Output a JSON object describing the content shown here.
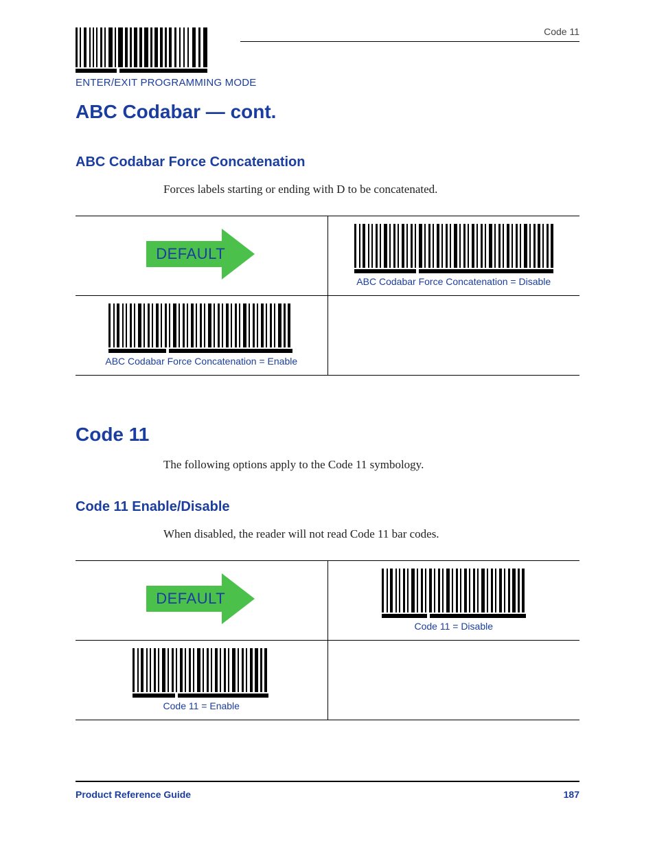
{
  "header": {
    "section_label": "Code 11",
    "enter_exit": "ENTER/EXIT PROGRAMMING MODE"
  },
  "titles": {
    "main": "ABC Codabar — cont.",
    "sub1": "ABC Codabar Force Concatenation",
    "section2": "Code 11",
    "sub2": "Code 11 Enable/Disable"
  },
  "paragraphs": {
    "p1": "Forces labels starting or ending with D to be concatenated.",
    "p2": "The following options apply to the Code 11 symbology.",
    "p3": "When disabled, the reader will not read Code 11 bar codes."
  },
  "arrow_label": "DEFAULT",
  "barcodes": {
    "abc_disable": "ABC Codabar Force Concatenation = Disable",
    "abc_enable": "ABC Codabar Force Concatenation = Enable",
    "c11_disable": "Code 11 = Disable",
    "c11_enable": "Code 11 = Enable"
  },
  "footer": {
    "left": "Product Reference Guide",
    "page": "187"
  }
}
